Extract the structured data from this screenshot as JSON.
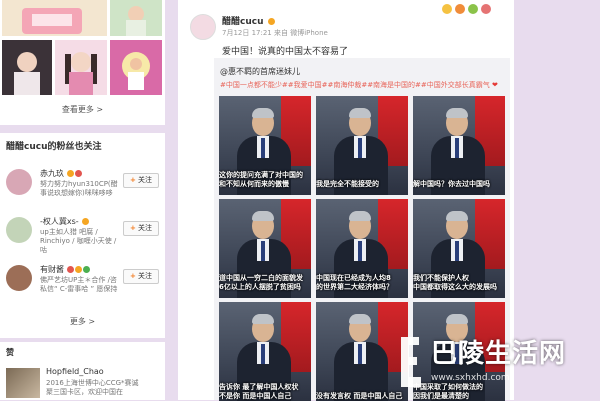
{
  "sidebar": {
    "more_photos_label": "查看更多 >",
    "fans_title": "醋醋cucu的粉丝也关注",
    "follow_label": "关注",
    "fans": [
      {
        "name": "赤九玖",
        "desc": "努力努力hyun310CP(醋\n事说玖想嫁你)咪咪哆哆",
        "avatar_color": "#d8a7b5"
      },
      {
        "name": "-权人冀xs-",
        "desc": "up主如人猎 吧腐 /\nRinchiyo / 咖喱小天使 / 咕",
        "avatar_color": "#c3d4b8"
      },
      {
        "name": "有财酱",
        "desc": "佛严艺坊UP主＊合作 /咨\n私信“ C-雷事哈 ” 愿保持",
        "avatar_color": "#9c6e57"
      }
    ],
    "more_fans_label": "更多 >",
    "like_title": "赞",
    "like_user": {
      "name": "Hopfield_Chao",
      "desc": "2016上海世博中心CCG*赛诚\n聚三国卡区，欢迎中国在"
    }
  },
  "post": {
    "author": "醋醋cucu",
    "meta": "7月12日 17:21 来自 微博iPhone",
    "text": "爱中国！说真的中国太不容易了",
    "repost_author": "@惠不羁的首席迷妹儿",
    "repost_tags": "#中国一点都不能少##我爱中国##南海仲裁##南海是中国的##中国外交部长真霸气",
    "images": [
      {
        "caption": "这你的提问充满了对中国的\n和不知从何而来的傲慢"
      },
      {
        "caption": "我是完全不能接受的"
      },
      {
        "caption": "解中国吗？你去过中国吗"
      },
      {
        "caption": "道中国从一穷二白的面貌发\n6亿以上的人摆脱了贫困吗"
      },
      {
        "caption": "中国现在已经成为人均8\n的世界第二大经济体吗？"
      },
      {
        "caption": "我们不能保护人权\n中国都取得这么大的发展吗"
      },
      {
        "caption": "告诉你 最了解中国人权状\n不是你 而是中国人自己"
      },
      {
        "caption": "没有发言权 而是中国人自己"
      },
      {
        "caption": "中国采取了如何做法的\n因我们是最清楚的"
      }
    ]
  },
  "watermark": {
    "text": "巴陵生活网",
    "url": "www.sxhxhd.com"
  },
  "colors": {
    "page_bg": "#e8dcee",
    "tag_color": "#e8655a",
    "follow_plus": "#f27c22"
  }
}
